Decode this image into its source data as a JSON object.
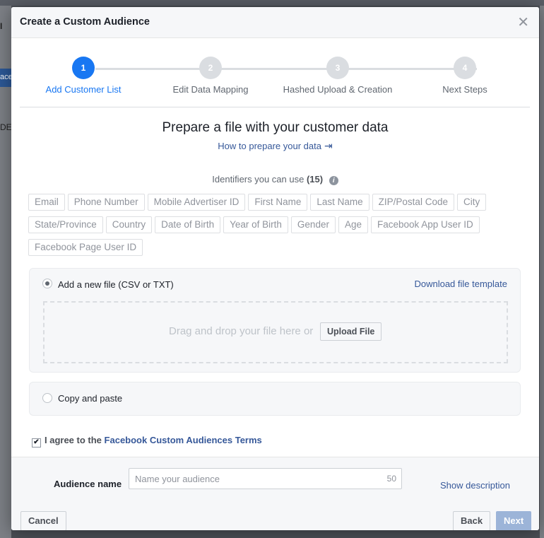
{
  "background": {
    "fragment_i": "I",
    "fragment_ace": "ace",
    "fragment_de": "DE"
  },
  "dialog": {
    "title": "Create a Custom Audience",
    "close_icon": "close-icon"
  },
  "stepper": {
    "steps": [
      {
        "number": "1",
        "label": "Add Customer List",
        "active": true
      },
      {
        "number": "2",
        "label": "Edit Data Mapping",
        "active": false
      },
      {
        "number": "3",
        "label": "Hashed Upload & Creation",
        "active": false
      },
      {
        "number": "4",
        "label": "Next Steps",
        "active": false
      }
    ]
  },
  "prepare": {
    "title": "Prepare a file with your customer data",
    "how_link": "How to prepare your data"
  },
  "identifiers": {
    "title": "Identifiers you can use",
    "count": "(15)",
    "items": [
      "Email",
      "Phone Number",
      "Mobile Advertiser ID",
      "First Name",
      "Last Name",
      "ZIP/Postal Code",
      "City",
      "State/Province",
      "Country",
      "Date of Birth",
      "Year of Birth",
      "Gender",
      "Age",
      "Facebook App User ID",
      "Facebook Page User ID"
    ]
  },
  "file_option": {
    "label": "Add a new file (CSV or TXT)",
    "selected": true,
    "download_link": "Download file template",
    "drop_text": "Drag and drop your file here or",
    "upload_button": "Upload File"
  },
  "paste_option": {
    "label": "Copy and paste",
    "selected": false
  },
  "agreement": {
    "checked": true,
    "prefix": "I agree to the",
    "link": "Facebook Custom Audiences Terms"
  },
  "footer": {
    "audience_label": "Audience name",
    "audience_placeholder": "Name your audience",
    "char_limit": "50",
    "show_description": "Show description",
    "cancel": "Cancel",
    "back": "Back",
    "next": "Next"
  },
  "colors": {
    "accent": "#1877f2",
    "link": "#365899",
    "next_disabled": "#9cb4d8"
  }
}
